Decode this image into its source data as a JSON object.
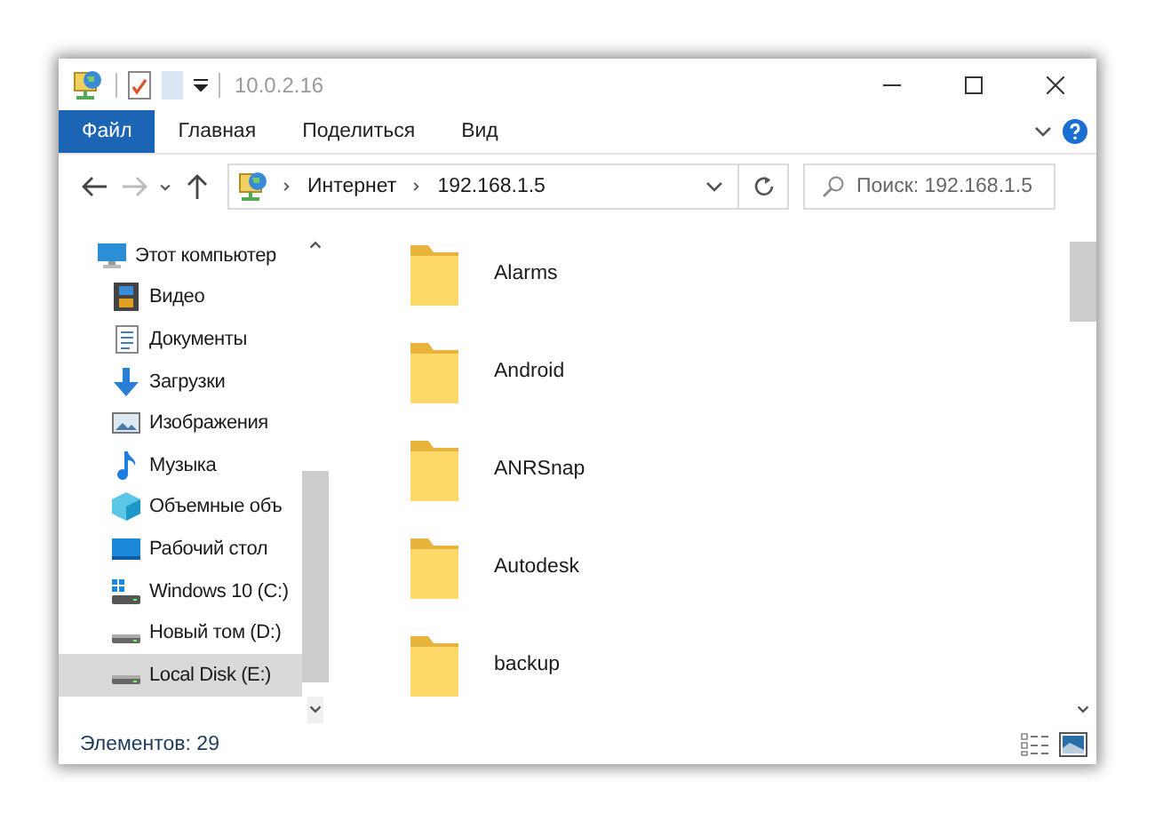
{
  "window": {
    "title": "10.0.2.16"
  },
  "ribbon_tabs": [
    {
      "label": "Файл",
      "selected": true
    },
    {
      "label": "Главная",
      "selected": false
    },
    {
      "label": "Поделиться",
      "selected": false
    },
    {
      "label": "Вид",
      "selected": false
    }
  ],
  "address": {
    "path": [
      "Интернет",
      "192.168.1.5"
    ]
  },
  "search": {
    "placeholder": "Поиск: 192.168.1.5"
  },
  "nav": [
    {
      "label": "Этот компьютер",
      "kind": "computer",
      "selected": false,
      "children": [
        {
          "label": "Видео",
          "kind": "video",
          "selected": false
        },
        {
          "label": "Документы",
          "kind": "docs",
          "selected": false
        },
        {
          "label": "Загрузки",
          "kind": "download",
          "selected": false
        },
        {
          "label": "Изображения",
          "kind": "pictures",
          "selected": false
        },
        {
          "label": "Музыка",
          "kind": "music",
          "selected": false
        },
        {
          "label": "Объемные объ",
          "kind": "cube",
          "selected": false
        },
        {
          "label": "Рабочий стол",
          "kind": "desktop",
          "selected": false
        },
        {
          "label": "Windows 10 (C:)",
          "kind": "windrive",
          "selected": false
        },
        {
          "label": "Новый том (D:)",
          "kind": "drive",
          "selected": false
        },
        {
          "label": "Local Disk (E:)",
          "kind": "drive",
          "selected": true
        }
      ]
    }
  ],
  "folders": [
    {
      "name": "Alarms"
    },
    {
      "name": "Android"
    },
    {
      "name": "ANRSnap"
    },
    {
      "name": "Autodesk"
    },
    {
      "name": "backup"
    }
  ],
  "status_bar": {
    "count": "Элементов: 29"
  }
}
